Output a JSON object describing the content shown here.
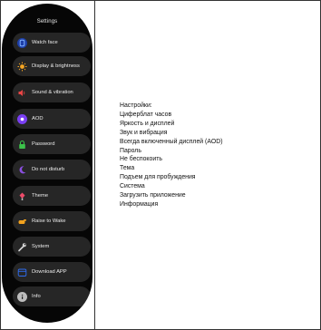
{
  "watch": {
    "title": "Settings",
    "items": [
      {
        "label": "Watch face",
        "icon": "watch-face-icon",
        "color": "#3a6df0",
        "multi": false
      },
      {
        "label": "Display & brightness",
        "icon": "sun-icon",
        "color": "#f5a623",
        "multi": true
      },
      {
        "label": "Sound & vibration",
        "icon": "speaker-icon",
        "color": "#e84545",
        "multi": true
      },
      {
        "label": "AOD",
        "icon": "aod-icon",
        "color": "#7a3ff2",
        "multi": false
      },
      {
        "label": "Password",
        "icon": "lock-icon",
        "color": "#3cc24a",
        "multi": false
      },
      {
        "label": "Do not disturb",
        "icon": "moon-icon",
        "color": "#8a4fe0",
        "multi": true
      },
      {
        "label": "Theme",
        "icon": "theme-icon",
        "color": "#ee4b6a",
        "multi": false
      },
      {
        "label": "Raise to Wake",
        "icon": "raise-hand-icon",
        "color": "#f2a21e",
        "multi": false
      },
      {
        "label": "System",
        "icon": "wrench-icon",
        "color": "#cfcfcf",
        "multi": false
      },
      {
        "label": "Download APP",
        "icon": "download-app-icon",
        "color": "#2f6cf0",
        "multi": false
      },
      {
        "label": "Info",
        "icon": "info-icon",
        "color": "#bdbdbd",
        "multi": false
      }
    ]
  },
  "info": {
    "lines": [
      "Настройки:",
      "Циферблат часов",
      "Яркость и дисплей",
      "Звук и вибрация",
      "Всегда включенный дисплей (AOD)",
      "Пароль",
      "Не беспокоить",
      "Тема",
      "Подъем для пробуждения",
      "Система",
      "Загрузить приложение",
      "Информация"
    ]
  }
}
